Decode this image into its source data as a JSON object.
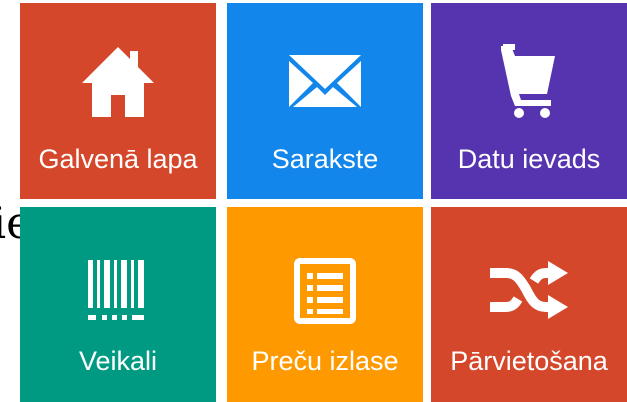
{
  "background_text": "ie",
  "tiles": [
    {
      "label": "Galvenā lapa",
      "icon": "home-icon",
      "color": "#d5472b"
    },
    {
      "label": "Sarakste",
      "icon": "envelope-icon",
      "color": "#1286ea"
    },
    {
      "label": "Datu ievads",
      "icon": "shopping-cart-icon",
      "color": "#5634b0"
    },
    {
      "label": "Veikali",
      "icon": "barcode-icon",
      "color": "#009a83"
    },
    {
      "label": "Preču izlase",
      "icon": "list-icon",
      "color": "#ff9900"
    },
    {
      "label": "Pārvietošana",
      "icon": "shuffle-icon",
      "color": "#d5472b"
    }
  ]
}
